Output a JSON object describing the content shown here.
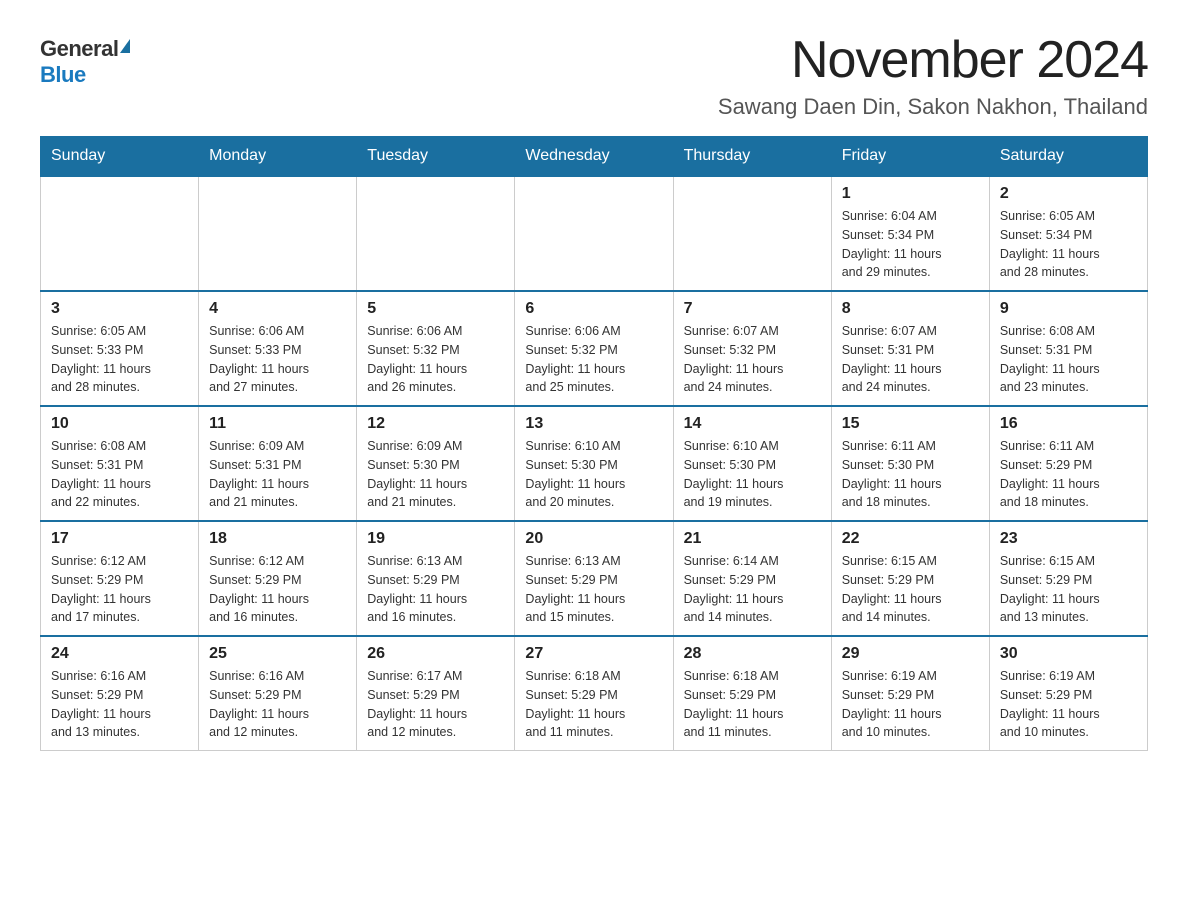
{
  "header": {
    "logo_general": "General",
    "logo_blue": "Blue",
    "title": "November 2024",
    "subtitle": "Sawang Daen Din, Sakon Nakhon, Thailand"
  },
  "days_of_week": [
    "Sunday",
    "Monday",
    "Tuesday",
    "Wednesday",
    "Thursday",
    "Friday",
    "Saturday"
  ],
  "weeks": [
    {
      "days": [
        {
          "number": "",
          "info": ""
        },
        {
          "number": "",
          "info": ""
        },
        {
          "number": "",
          "info": ""
        },
        {
          "number": "",
          "info": ""
        },
        {
          "number": "",
          "info": ""
        },
        {
          "number": "1",
          "info": "Sunrise: 6:04 AM\nSunset: 5:34 PM\nDaylight: 11 hours\nand 29 minutes."
        },
        {
          "number": "2",
          "info": "Sunrise: 6:05 AM\nSunset: 5:34 PM\nDaylight: 11 hours\nand 28 minutes."
        }
      ]
    },
    {
      "days": [
        {
          "number": "3",
          "info": "Sunrise: 6:05 AM\nSunset: 5:33 PM\nDaylight: 11 hours\nand 28 minutes."
        },
        {
          "number": "4",
          "info": "Sunrise: 6:06 AM\nSunset: 5:33 PM\nDaylight: 11 hours\nand 27 minutes."
        },
        {
          "number": "5",
          "info": "Sunrise: 6:06 AM\nSunset: 5:32 PM\nDaylight: 11 hours\nand 26 minutes."
        },
        {
          "number": "6",
          "info": "Sunrise: 6:06 AM\nSunset: 5:32 PM\nDaylight: 11 hours\nand 25 minutes."
        },
        {
          "number": "7",
          "info": "Sunrise: 6:07 AM\nSunset: 5:32 PM\nDaylight: 11 hours\nand 24 minutes."
        },
        {
          "number": "8",
          "info": "Sunrise: 6:07 AM\nSunset: 5:31 PM\nDaylight: 11 hours\nand 24 minutes."
        },
        {
          "number": "9",
          "info": "Sunrise: 6:08 AM\nSunset: 5:31 PM\nDaylight: 11 hours\nand 23 minutes."
        }
      ]
    },
    {
      "days": [
        {
          "number": "10",
          "info": "Sunrise: 6:08 AM\nSunset: 5:31 PM\nDaylight: 11 hours\nand 22 minutes."
        },
        {
          "number": "11",
          "info": "Sunrise: 6:09 AM\nSunset: 5:31 PM\nDaylight: 11 hours\nand 21 minutes."
        },
        {
          "number": "12",
          "info": "Sunrise: 6:09 AM\nSunset: 5:30 PM\nDaylight: 11 hours\nand 21 minutes."
        },
        {
          "number": "13",
          "info": "Sunrise: 6:10 AM\nSunset: 5:30 PM\nDaylight: 11 hours\nand 20 minutes."
        },
        {
          "number": "14",
          "info": "Sunrise: 6:10 AM\nSunset: 5:30 PM\nDaylight: 11 hours\nand 19 minutes."
        },
        {
          "number": "15",
          "info": "Sunrise: 6:11 AM\nSunset: 5:30 PM\nDaylight: 11 hours\nand 18 minutes."
        },
        {
          "number": "16",
          "info": "Sunrise: 6:11 AM\nSunset: 5:29 PM\nDaylight: 11 hours\nand 18 minutes."
        }
      ]
    },
    {
      "days": [
        {
          "number": "17",
          "info": "Sunrise: 6:12 AM\nSunset: 5:29 PM\nDaylight: 11 hours\nand 17 minutes."
        },
        {
          "number": "18",
          "info": "Sunrise: 6:12 AM\nSunset: 5:29 PM\nDaylight: 11 hours\nand 16 minutes."
        },
        {
          "number": "19",
          "info": "Sunrise: 6:13 AM\nSunset: 5:29 PM\nDaylight: 11 hours\nand 16 minutes."
        },
        {
          "number": "20",
          "info": "Sunrise: 6:13 AM\nSunset: 5:29 PM\nDaylight: 11 hours\nand 15 minutes."
        },
        {
          "number": "21",
          "info": "Sunrise: 6:14 AM\nSunset: 5:29 PM\nDaylight: 11 hours\nand 14 minutes."
        },
        {
          "number": "22",
          "info": "Sunrise: 6:15 AM\nSunset: 5:29 PM\nDaylight: 11 hours\nand 14 minutes."
        },
        {
          "number": "23",
          "info": "Sunrise: 6:15 AM\nSunset: 5:29 PM\nDaylight: 11 hours\nand 13 minutes."
        }
      ]
    },
    {
      "days": [
        {
          "number": "24",
          "info": "Sunrise: 6:16 AM\nSunset: 5:29 PM\nDaylight: 11 hours\nand 13 minutes."
        },
        {
          "number": "25",
          "info": "Sunrise: 6:16 AM\nSunset: 5:29 PM\nDaylight: 11 hours\nand 12 minutes."
        },
        {
          "number": "26",
          "info": "Sunrise: 6:17 AM\nSunset: 5:29 PM\nDaylight: 11 hours\nand 12 minutes."
        },
        {
          "number": "27",
          "info": "Sunrise: 6:18 AM\nSunset: 5:29 PM\nDaylight: 11 hours\nand 11 minutes."
        },
        {
          "number": "28",
          "info": "Sunrise: 6:18 AM\nSunset: 5:29 PM\nDaylight: 11 hours\nand 11 minutes."
        },
        {
          "number": "29",
          "info": "Sunrise: 6:19 AM\nSunset: 5:29 PM\nDaylight: 11 hours\nand 10 minutes."
        },
        {
          "number": "30",
          "info": "Sunrise: 6:19 AM\nSunset: 5:29 PM\nDaylight: 11 hours\nand 10 minutes."
        }
      ]
    }
  ]
}
